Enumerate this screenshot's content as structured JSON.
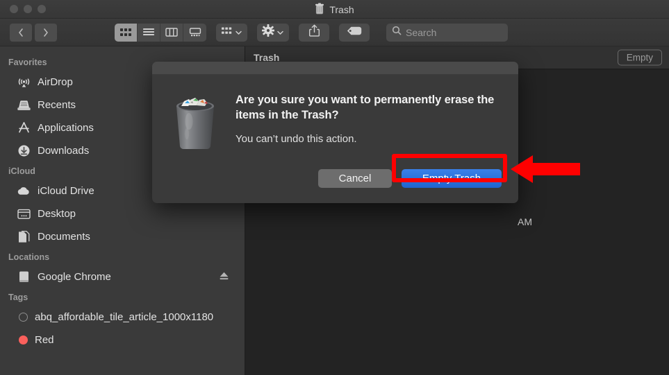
{
  "window": {
    "title": "Trash",
    "title_icon": "trash-icon",
    "traffic_lights": [
      "close",
      "minimize",
      "zoom"
    ]
  },
  "toolbar": {
    "back_icon": "chevron-left-icon",
    "forward_icon": "chevron-right-icon",
    "view_modes": [
      {
        "name": "icon-view",
        "icon": "grid-icon",
        "selected": true
      },
      {
        "name": "list-view",
        "icon": "list-icon",
        "selected": false
      },
      {
        "name": "column-view",
        "icon": "columns-icon",
        "selected": false
      },
      {
        "name": "gallery-view",
        "icon": "gallery-icon",
        "selected": false
      }
    ],
    "group_by": {
      "name": "group-by-dropdown",
      "icon": "grid-small-icon",
      "chevron": "chevron-down-icon"
    },
    "action": {
      "name": "action-dropdown",
      "icon": "gear-icon",
      "chevron": "chevron-down-icon"
    },
    "share": {
      "name": "share-button",
      "icon": "share-icon"
    },
    "tags": {
      "name": "tags-button",
      "icon": "tag-icon"
    },
    "search": {
      "icon": "search-icon",
      "placeholder": "Search",
      "value": ""
    }
  },
  "sidebar": {
    "sections": [
      {
        "header": "Favorites",
        "items": [
          {
            "label": "AirDrop",
            "icon": "airdrop-icon"
          },
          {
            "label": "Recents",
            "icon": "recents-icon"
          },
          {
            "label": "Applications",
            "icon": "applications-icon"
          },
          {
            "label": "Downloads",
            "icon": "downloads-icon"
          }
        ]
      },
      {
        "header": "iCloud",
        "items": [
          {
            "label": "iCloud Drive",
            "icon": "cloud-icon"
          },
          {
            "label": "Desktop",
            "icon": "desktop-icon"
          },
          {
            "label": "Documents",
            "icon": "documents-icon"
          }
        ]
      },
      {
        "header": "Locations",
        "items": [
          {
            "label": "Google Chrome",
            "icon": "disk-icon",
            "eject": true
          }
        ]
      },
      {
        "header": "Tags",
        "items": [
          {
            "label": "abq_affordable_tile_article_1000x1180",
            "icon": "tag-dot",
            "color": "none"
          },
          {
            "label": "Red",
            "icon": "tag-dot",
            "color": "#fb605c"
          }
        ]
      }
    ]
  },
  "content": {
    "title": "Trash",
    "empty_button": "Empty",
    "background_text": "AM"
  },
  "dialog": {
    "icon": "full-trash-icon",
    "heading": "Are you sure you want to permanently erase the items in the Trash?",
    "subtext": "You can’t undo this action.",
    "cancel_label": "Cancel",
    "confirm_label": "Empty Trash"
  },
  "annotations": {
    "highlight_color": "#ff0000",
    "arrow_color": "#ff0000",
    "target": "Empty Trash"
  },
  "colors": {
    "accent_blue": "#2a70d8",
    "annotation_red": "#ff0000",
    "sidebar_bg": "#3a3a3a",
    "content_bg": "#232323",
    "tag_red": "#fb605c"
  }
}
